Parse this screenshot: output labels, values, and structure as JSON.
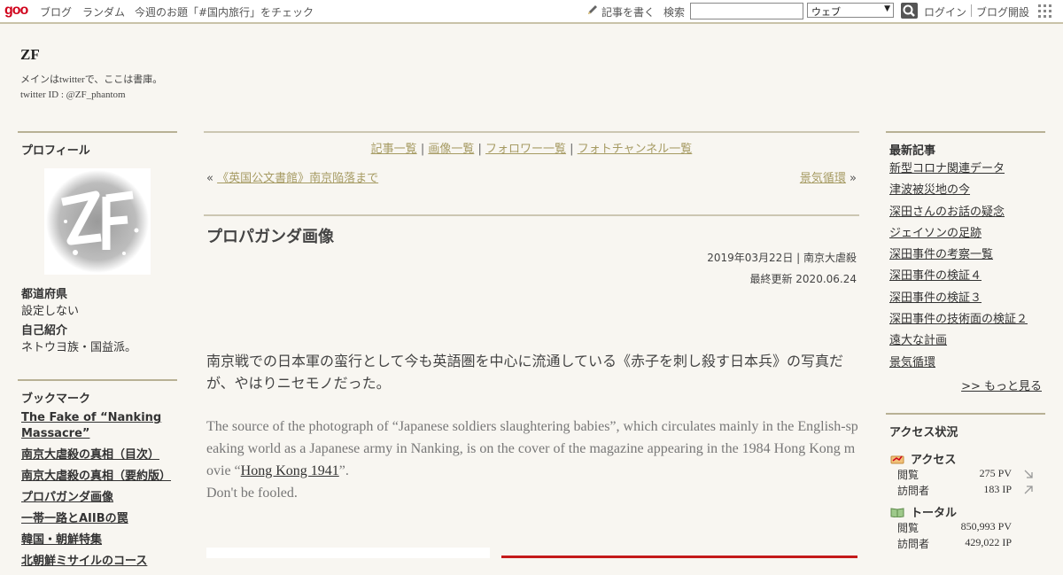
{
  "topbar": {
    "logo": "goo",
    "links": [
      "ブログ",
      "ランダム",
      "今週のお題「#国内旅行」をチェック"
    ],
    "write_label": "記事を書く",
    "search_label": "検索",
    "search_value": "",
    "select_value": "ウェブ",
    "login": "ログイン",
    "open_blog": "ブログ開設"
  },
  "header": {
    "title": "ZF",
    "desc_line1": "メインはtwitterで、ここは書庫。",
    "desc_line2": "twitter ID : @ZF_phantom"
  },
  "left": {
    "profile_title": "プロフィール",
    "pref_label": "都道府県",
    "pref_value": "設定しない",
    "intro_label": "自己紹介",
    "intro_value": "ネトウヨ族・国益派。",
    "bookmark_title": "ブックマーク",
    "bookmarks": [
      "The Fake of “Nanking Massacre”",
      "南京大虐殺の真相（目次）",
      "南京大虐殺の真相（要約版）",
      "プロパガンダ画像",
      "一帯一路とAIIBの罠",
      "韓国・朝鮮特集",
      "北朝鮮ミサイルのコース"
    ]
  },
  "center": {
    "nav": [
      "記事一覧",
      "画像一覧",
      "フォロワー一覧",
      "フォトチャンネル一覧"
    ],
    "prev_mark": "«",
    "prev_title": "《英国公文書館》南京陥落まで",
    "next_title": "景気循環",
    "next_mark": "»",
    "title": "プロパガンダ画像",
    "meta": "2019年03月22日 | 南京大虐殺",
    "updated": "最終更新 2020.06.24",
    "body_jp": "南京戦での日本軍の蛮行として今も英語圏を中心に流通している《赤子を刺し殺す日本兵》の写真だが、やはりニセモノだった。",
    "body_en_pre": "The source of the photograph of “Japanese soldiers slaughtering babies”, which circulates mainly in the English-speaking world as a Japanese army in Nanking, is on the cover of the magazine appearing in the 1984 Hong Kong movie “",
    "body_en_link": "Hong Kong 1941",
    "body_en_post": "”.",
    "body_en_last": "Don't be fooled."
  },
  "right": {
    "recent_title": "最新記事",
    "recent": [
      "新型コロナ関連データ",
      "津波被災地の今",
      "深田さんのお話の疑念",
      "ジェイソンの足跡",
      "深田事件の考察一覧",
      "深田事件の検証４",
      "深田事件の検証３",
      "深田事件の技術面の検証２",
      "遠大な計画",
      "景気循環"
    ],
    "more": ">> もっと見る",
    "access_title": "アクセス状況",
    "access_label": "アクセス",
    "total_label": "トータル",
    "view_label": "閲覧",
    "visitor_label": "訪問者",
    "access_views": "275 PV",
    "access_visitors": "183 IP",
    "total_views": "850,993 PV",
    "total_visitors": "429,022 IP"
  }
}
